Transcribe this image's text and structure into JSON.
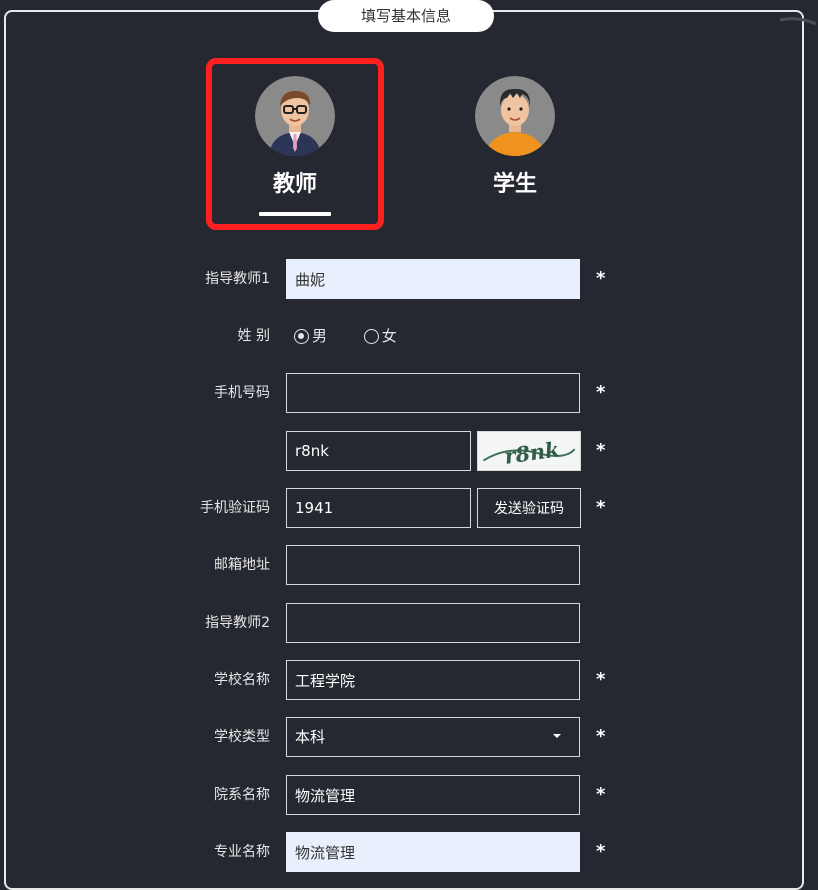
{
  "header": {
    "title": "填写基本信息"
  },
  "roles": [
    {
      "label": "教师",
      "selected": true
    },
    {
      "label": "学生",
      "selected": false
    }
  ],
  "form": {
    "advisor1": {
      "label": "指导教师1",
      "value": "曲妮"
    },
    "gender": {
      "label": "姓 别",
      "options": [
        "男",
        "女"
      ],
      "selected": "男"
    },
    "phone": {
      "label": "手机号码",
      "value": ""
    },
    "captcha": {
      "value": "r8nk",
      "image_text": "r8nk"
    },
    "sms_code": {
      "label": "手机验证码",
      "value": "1941",
      "button": "发送验证码"
    },
    "email": {
      "label": "邮箱地址",
      "value": ""
    },
    "advisor2": {
      "label": "指导教师2",
      "value": ""
    },
    "school_name": {
      "label": "学校名称",
      "value": "工程学院"
    },
    "school_type": {
      "label": "学校类型",
      "value": "本科"
    },
    "department": {
      "label": "院系名称",
      "value": "物流管理"
    },
    "major": {
      "label": "专业名称",
      "value": "物流管理"
    },
    "required_mark": "*"
  },
  "colors": {
    "background": "#252830",
    "highlight_border": "#ff2020",
    "autofill": "#e8f0fe"
  }
}
